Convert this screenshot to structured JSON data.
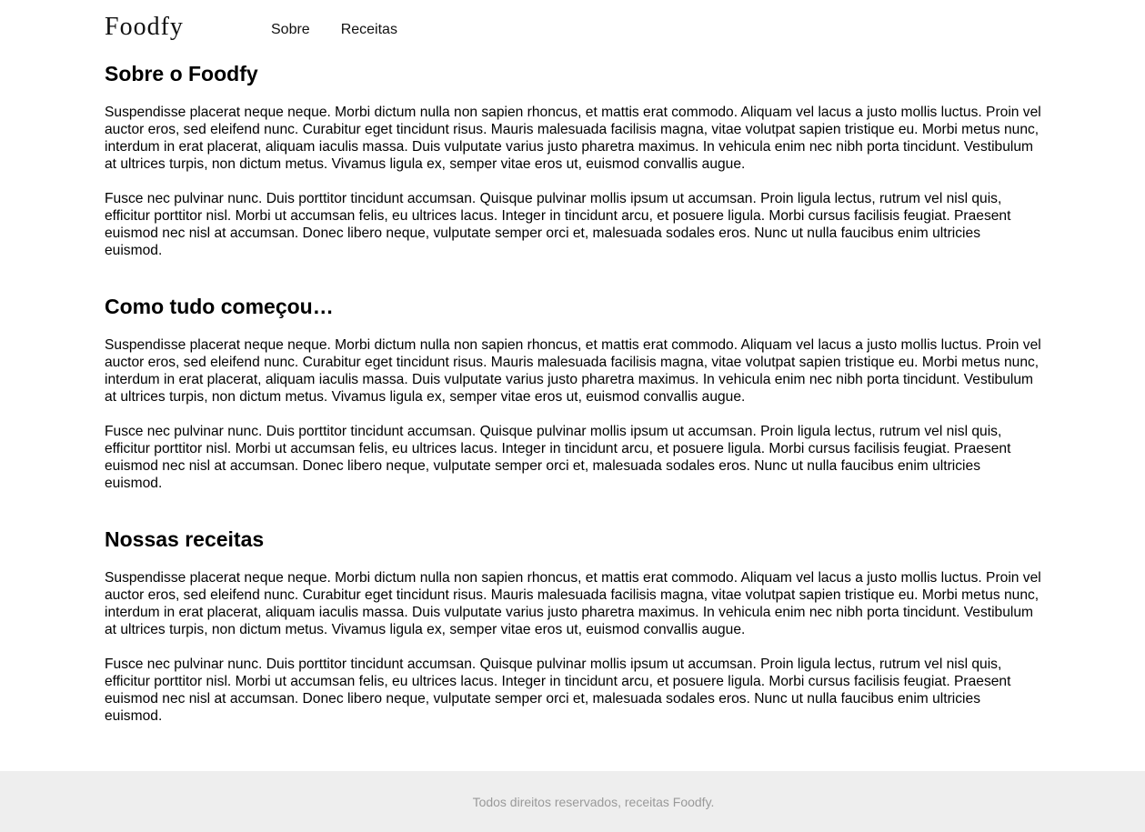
{
  "header": {
    "logo": "Foodfy",
    "nav": [
      {
        "label": "Sobre"
      },
      {
        "label": "Receitas"
      }
    ]
  },
  "sections": [
    {
      "title": "Sobre o Foodfy",
      "paragraphs": [
        "Suspendisse placerat neque neque. Morbi dictum nulla non sapien rhoncus, et mattis erat commodo. Aliquam vel lacus a justo mollis luctus. Proin vel auctor eros, sed eleifend nunc. Curabitur eget tincidunt risus. Mauris malesuada facilisis magna, vitae volutpat sapien tristique eu. Morbi metus nunc, interdum in erat placerat, aliquam iaculis massa. Duis vulputate varius justo pharetra maximus. In vehicula enim nec nibh porta tincidunt. Vestibulum at ultrices turpis, non dictum metus. Vivamus ligula ex, semper vitae eros ut, euismod convallis augue.",
        "Fusce nec pulvinar nunc. Duis porttitor tincidunt accumsan. Quisque pulvinar mollis ipsum ut accumsan. Proin ligula lectus, rutrum vel nisl quis, efficitur porttitor nisl. Morbi ut accumsan felis, eu ultrices lacus. Integer in tincidunt arcu, et posuere ligula. Morbi cursus facilisis feugiat. Praesent euismod nec nisl at accumsan. Donec libero neque, vulputate semper orci et, malesuada sodales eros. Nunc ut nulla faucibus enim ultricies euismod."
      ]
    },
    {
      "title": "Como tudo começou…",
      "paragraphs": [
        "Suspendisse placerat neque neque. Morbi dictum nulla non sapien rhoncus, et mattis erat commodo. Aliquam vel lacus a justo mollis luctus. Proin vel auctor eros, sed eleifend nunc. Curabitur eget tincidunt risus. Mauris malesuada facilisis magna, vitae volutpat sapien tristique eu. Morbi metus nunc, interdum in erat placerat, aliquam iaculis massa. Duis vulputate varius justo pharetra maximus. In vehicula enim nec nibh porta tincidunt. Vestibulum at ultrices turpis, non dictum metus. Vivamus ligula ex, semper vitae eros ut, euismod convallis augue.",
        "Fusce nec pulvinar nunc. Duis porttitor tincidunt accumsan. Quisque pulvinar mollis ipsum ut accumsan. Proin ligula lectus, rutrum vel nisl quis, efficitur porttitor nisl. Morbi ut accumsan felis, eu ultrices lacus. Integer in tincidunt arcu, et posuere ligula. Morbi cursus facilisis feugiat. Praesent euismod nec nisl at accumsan. Donec libero neque, vulputate semper orci et, malesuada sodales eros. Nunc ut nulla faucibus enim ultricies euismod."
      ]
    },
    {
      "title": "Nossas receitas",
      "paragraphs": [
        "Suspendisse placerat neque neque. Morbi dictum nulla non sapien rhoncus, et mattis erat commodo. Aliquam vel lacus a justo mollis luctus. Proin vel auctor eros, sed eleifend nunc. Curabitur eget tincidunt risus. Mauris malesuada facilisis magna, vitae volutpat sapien tristique eu. Morbi metus nunc, interdum in erat placerat, aliquam iaculis massa. Duis vulputate varius justo pharetra maximus. In vehicula enim nec nibh porta tincidunt. Vestibulum at ultrices turpis, non dictum metus. Vivamus ligula ex, semper vitae eros ut, euismod convallis augue.",
        "Fusce nec pulvinar nunc. Duis porttitor tincidunt accumsan. Quisque pulvinar mollis ipsum ut accumsan. Proin ligula lectus, rutrum vel nisl quis, efficitur porttitor nisl. Morbi ut accumsan felis, eu ultrices lacus. Integer in tincidunt arcu, et posuere ligula. Morbi cursus facilisis feugiat. Praesent euismod nec nisl at accumsan. Donec libero neque, vulputate semper orci et, malesuada sodales eros. Nunc ut nulla faucibus enim ultricies euismod."
      ]
    }
  ],
  "footer": {
    "text": "Todos direitos reservados, receitas Foodfy."
  },
  "colors": {
    "background": "#ffffff",
    "text": "#000000",
    "footer_background": "#eeeeee",
    "footer_text": "#999999"
  }
}
